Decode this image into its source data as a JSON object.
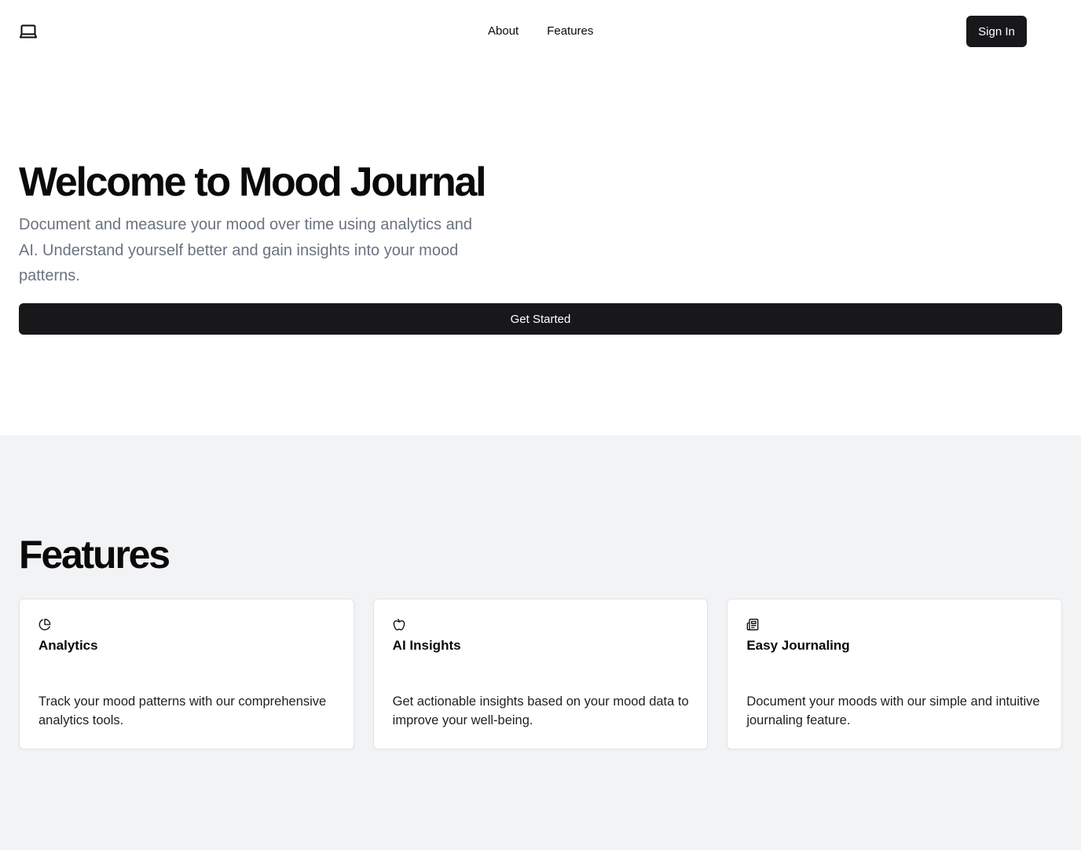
{
  "header": {
    "logo_icon": "laptop-icon",
    "nav": [
      {
        "label": "About"
      },
      {
        "label": "Features"
      }
    ],
    "signin_label": "Sign In"
  },
  "hero": {
    "title": "Welcome to Mood Journal",
    "subtitle": "Document and measure your mood over time using analytics and AI. Understand yourself better and gain insights into your mood patterns.",
    "cta_label": "Get Started"
  },
  "features": {
    "heading": "Features",
    "cards": [
      {
        "icon": "pie-chart-icon",
        "title": "Analytics",
        "description": "Track your mood patterns with our comprehensive analytics tools."
      },
      {
        "icon": "apple-icon",
        "title": "AI Insights",
        "description": "Get actionable insights based on your mood data to improve your well-being."
      },
      {
        "icon": "newspaper-icon",
        "title": "Easy Journaling",
        "description": "Document your moods with our simple and intuitive journaling feature."
      }
    ]
  },
  "colors": {
    "primary": "#18181b",
    "muted_text": "#6b7280",
    "section_bg": "#f2f3f5",
    "card_border": "#e4e4e7"
  }
}
